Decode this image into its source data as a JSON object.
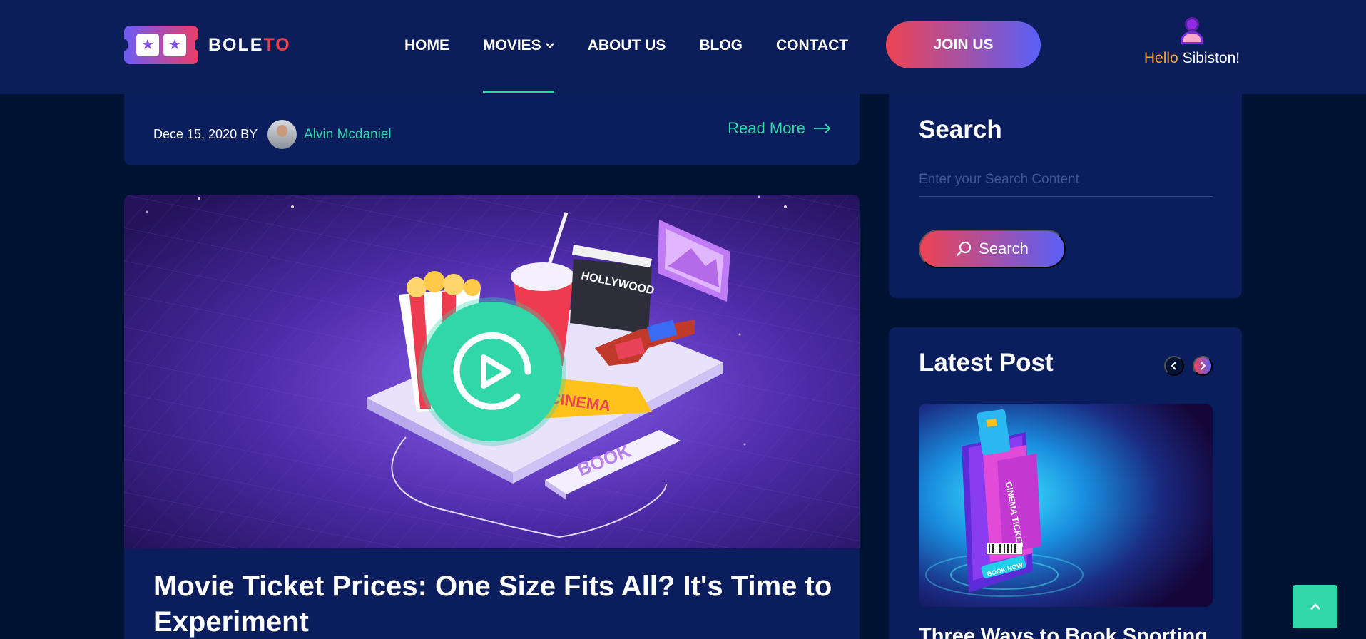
{
  "header": {
    "logo_text_main": "BOLE",
    "logo_text_accent": "TO",
    "nav": {
      "home": "HOME",
      "movies": "MOVIES",
      "about": "ABOUT US",
      "blog": "BLOG",
      "contact": "CONTACT"
    },
    "join_label": "JOIN US",
    "user": {
      "hello": "Hello",
      "name": " Sibiston!"
    }
  },
  "previous_post": {
    "date": "Dece 15, 2020 BY",
    "author": "Alvin Mcdaniel",
    "read_more": "Read More"
  },
  "article": {
    "title": "Movie Ticket Prices: One Size Fits All? It's Time to Experiment",
    "image_text": {
      "clapper": "HOLLYWOOD",
      "ticket": "CINEMA",
      "book": "BOOK"
    }
  },
  "sidebar": {
    "search": {
      "title": "Search",
      "placeholder": "Enter your Search Content",
      "button": "Search"
    },
    "latest": {
      "title": "Latest Post",
      "post_title": "Three Ways to Book Sporting",
      "image_text": {
        "ticket_label": "CINEMA TICKET",
        "book_now": "BOOK NOW"
      }
    }
  },
  "colors": {
    "header_bg": "#0b1e5a",
    "page_bg": "#001232",
    "card_bg": "#0a1e5e",
    "accent_green": "#31d7a9",
    "gradient_start": "#ef4353",
    "gradient_end": "#5960f9",
    "hello_orange": "#f6a334"
  }
}
